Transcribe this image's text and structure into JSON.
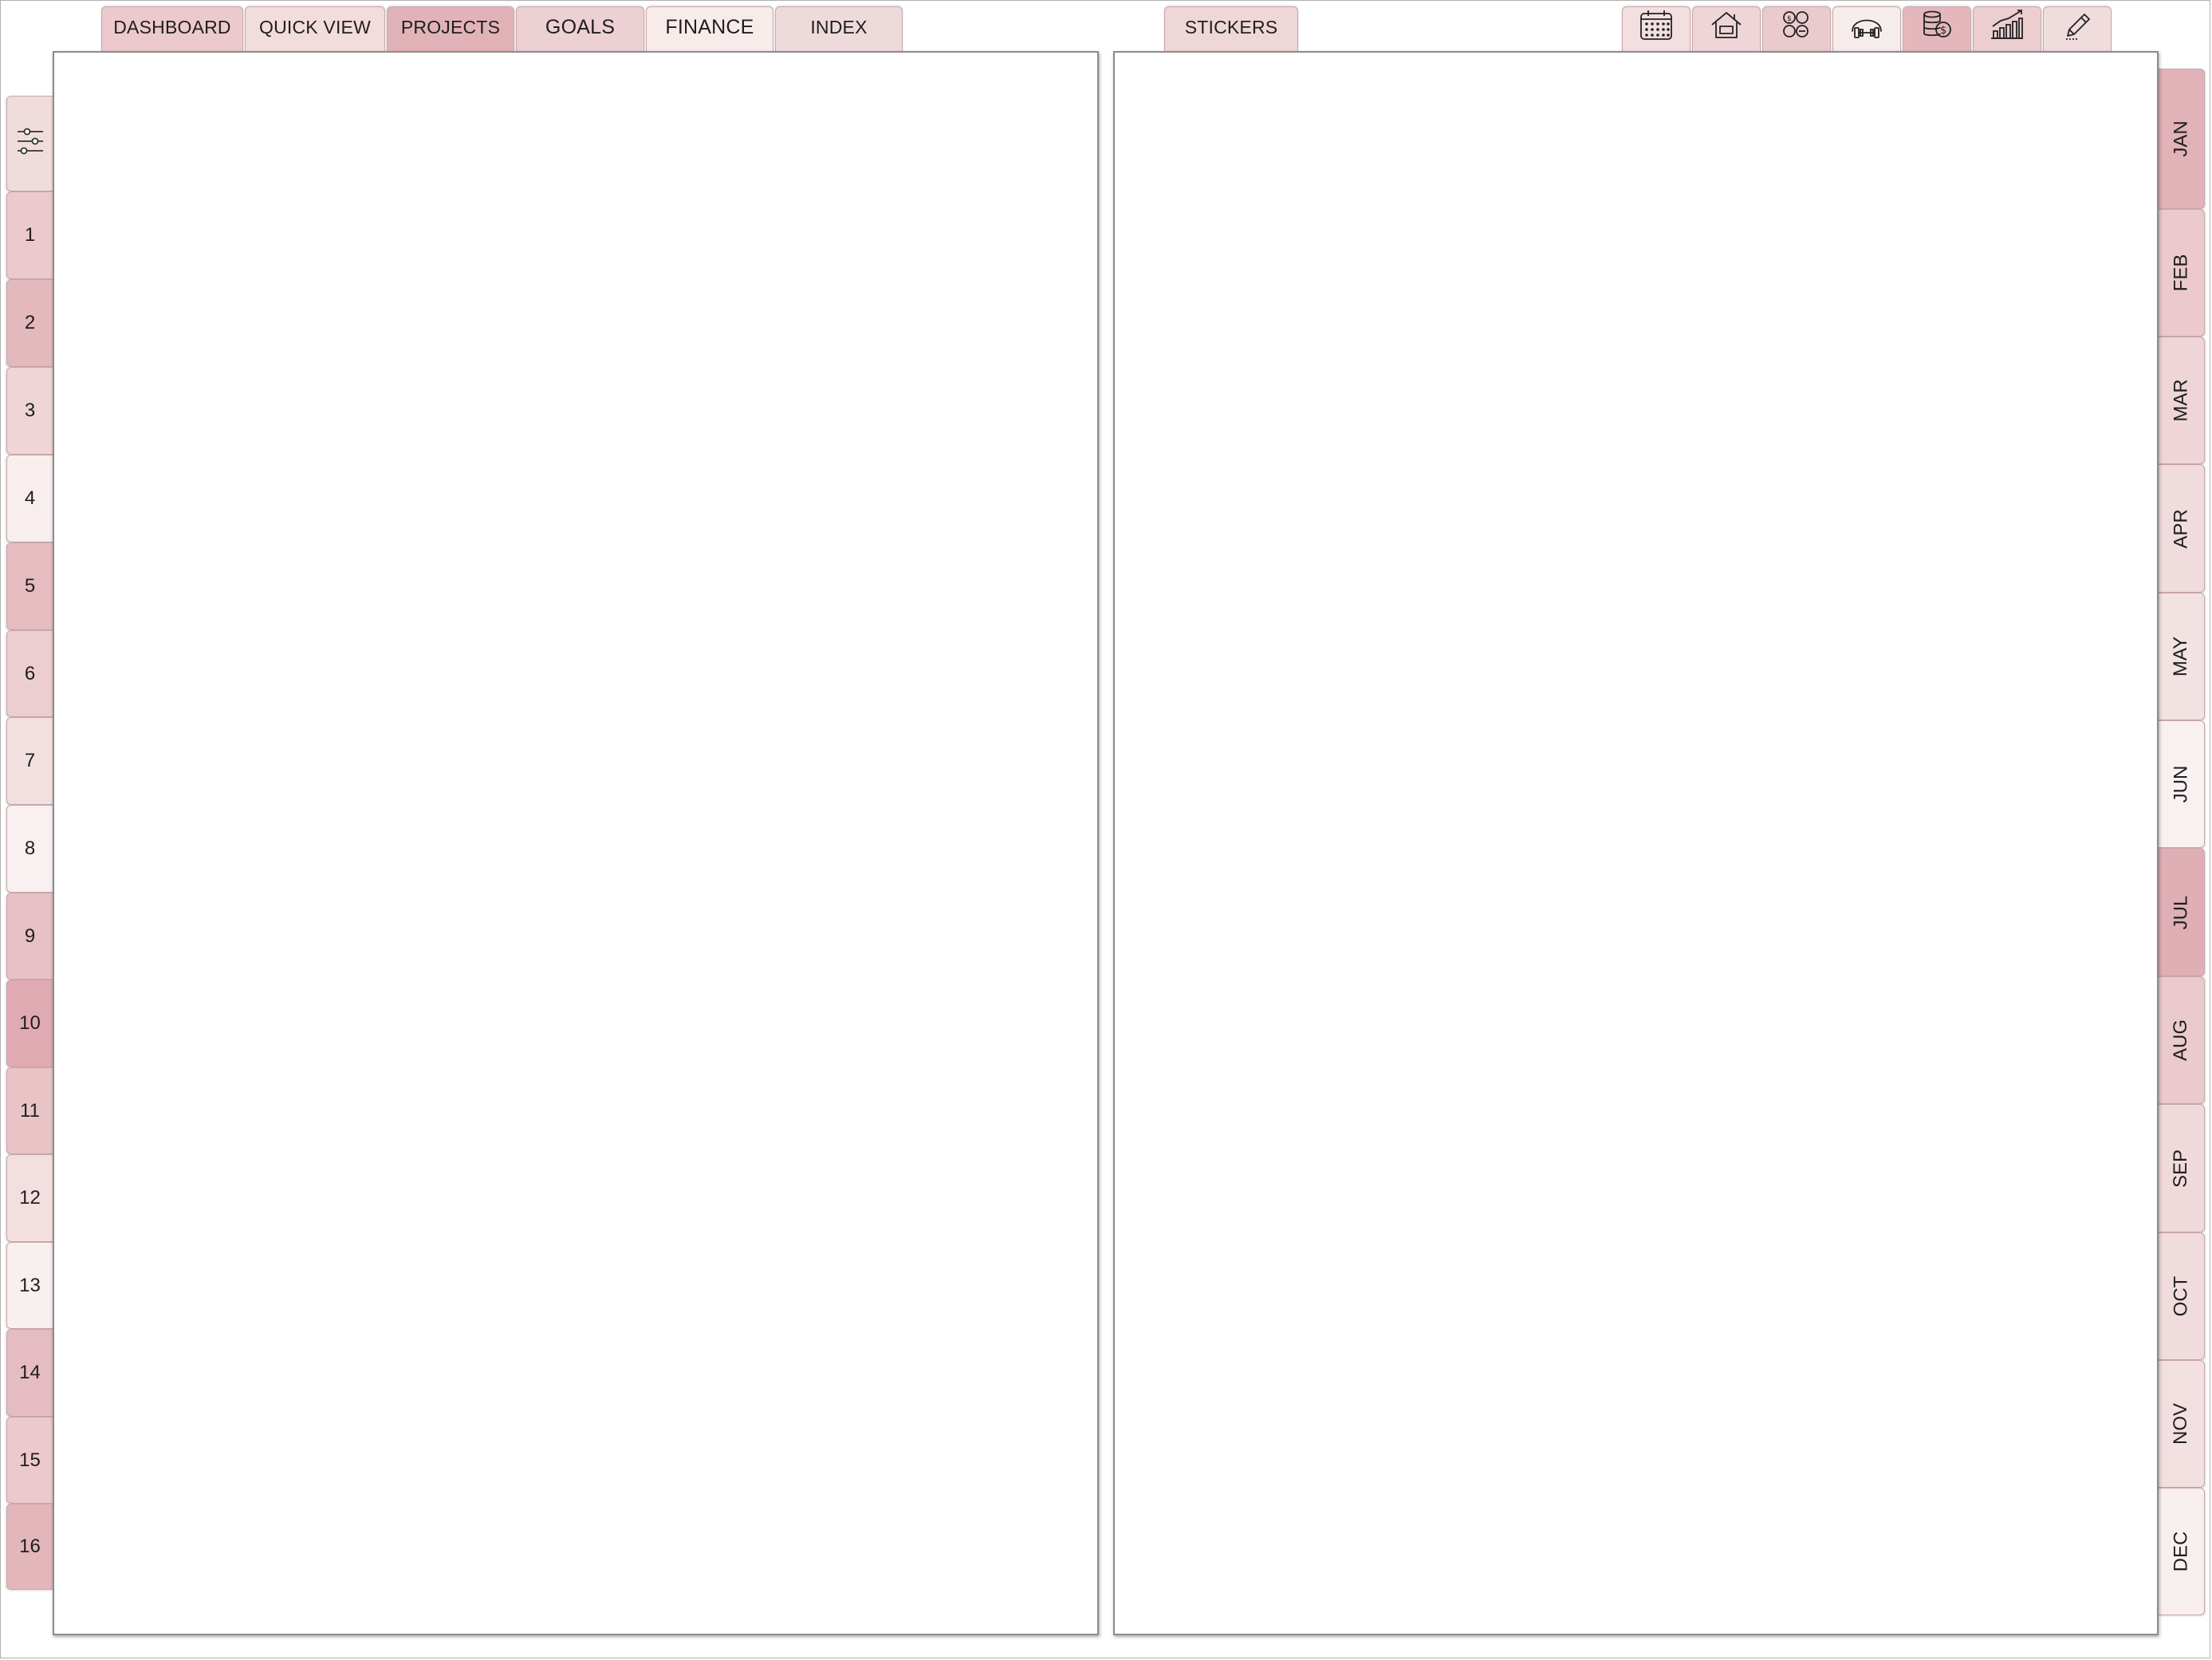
{
  "top_tabs": [
    {
      "label": "DASHBOARD",
      "color": "#ecc9cc"
    },
    {
      "label": "QUICK VIEW",
      "color": "#f2dcdc"
    },
    {
      "label": "PROJECTS",
      "color": "#e2b2b9"
    },
    {
      "label": "GOALS",
      "color": "#ecd0d3"
    },
    {
      "label": "FINANCE",
      "color": "#f8eceb"
    },
    {
      "label": "INDEX",
      "color": "#efdadb"
    }
  ],
  "stickers_tab": {
    "label": "STICKERS",
    "color": "#efd6d7"
  },
  "icon_tabs": [
    {
      "icon": "calendar-icon",
      "color": "#f3dfe0"
    },
    {
      "icon": "home-icon",
      "color": "#efd5d7"
    },
    {
      "icon": "goals-icon",
      "color": "#ebcacd"
    },
    {
      "icon": "fitness-icon",
      "color": "#f7ecec"
    },
    {
      "icon": "money-icon",
      "color": "#e4b7bd"
    },
    {
      "icon": "growth-chart-icon",
      "color": "#eccdd0"
    },
    {
      "icon": "pencil-icon",
      "color": "#f1dcdd"
    }
  ],
  "settings_tab": {
    "icon": "sliders-icon",
    "color": "#f1dcdc"
  },
  "side_tabs": [
    {
      "label": "1",
      "color": "#ecc9cc"
    },
    {
      "label": "2",
      "color": "#e3b9be"
    },
    {
      "label": "3",
      "color": "#efd5d6"
    },
    {
      "label": "4",
      "color": "#f8eeee"
    },
    {
      "label": "5",
      "color": "#e6bcc1"
    },
    {
      "label": "6",
      "color": "#eccdd0"
    },
    {
      "label": "7",
      "color": "#f2e0e0"
    },
    {
      "label": "8",
      "color": "#f9f1f1"
    },
    {
      "label": "9",
      "color": "#e7c1c5"
    },
    {
      "label": "10",
      "color": "#dfaab2"
    },
    {
      "label": "11",
      "color": "#e8c4c7"
    },
    {
      "label": "12",
      "color": "#f3dfdf"
    },
    {
      "label": "13",
      "color": "#f8efef"
    },
    {
      "label": "14",
      "color": "#e5bcc1"
    },
    {
      "label": "15",
      "color": "#ecc9cc"
    },
    {
      "label": "16",
      "color": "#e2b6bb"
    }
  ],
  "month_tabs": [
    {
      "label": "JAN",
      "color": "#e1b2b8"
    },
    {
      "label": "FEB",
      "color": "#ebc9cc"
    },
    {
      "label": "MAR",
      "color": "#efd5d7"
    },
    {
      "label": "APR",
      "color": "#f1dcdd"
    },
    {
      "label": "MAY",
      "color": "#f3e2e2"
    },
    {
      "label": "JUN",
      "color": "#f9f1f1"
    },
    {
      "label": "JUL",
      "color": "#e0aeb5"
    },
    {
      "label": "AUG",
      "color": "#ebcacd"
    },
    {
      "label": "SEP",
      "color": "#f0d9da"
    },
    {
      "label": "OCT",
      "color": "#f1dcdd"
    },
    {
      "label": "NOV",
      "color": "#f2dfe0"
    },
    {
      "label": "DEC",
      "color": "#f8efef"
    }
  ]
}
